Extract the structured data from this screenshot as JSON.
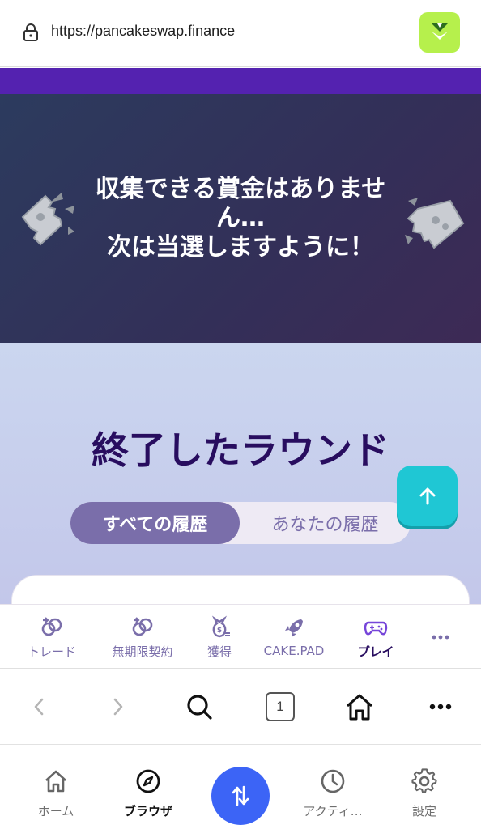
{
  "browser": {
    "url": "https://pancakeswap.finance",
    "icons": {
      "lock": "lock-icon",
      "wallet_logo": "wallet-logo-icon"
    }
  },
  "hero": {
    "message_line1": "収集できる賞金はありませ",
    "message_line2": "ん…",
    "message_line3": "次は当選しますように！"
  },
  "rounds": {
    "title": "終了したラウンド",
    "tabs": [
      {
        "label": "すべての履歴",
        "active": true
      },
      {
        "label": "あなたの履歴",
        "active": false
      }
    ]
  },
  "pcs_nav": {
    "items": [
      {
        "label": "トレード",
        "icon": "trade-icon"
      },
      {
        "label": "無期限契約",
        "icon": "perpetual-icon"
      },
      {
        "label": "獲得",
        "icon": "earn-icon"
      },
      {
        "label": "CAKE.PAD",
        "icon": "rocket-icon"
      },
      {
        "label": "プレイ",
        "icon": "gamepad-icon",
        "active": true
      },
      {
        "label": "",
        "icon": "more-icon"
      }
    ]
  },
  "browser_nav": {
    "tab_count": "1"
  },
  "app_tabbar": {
    "items": [
      {
        "label": "ホーム",
        "icon": "home-icon"
      },
      {
        "label": "ブラウザ",
        "icon": "compass-icon",
        "active": true
      },
      {
        "label": "",
        "icon": "swap-icon"
      },
      {
        "label": "アクティ…",
        "icon": "clock-icon"
      },
      {
        "label": "設定",
        "icon": "gear-icon"
      }
    ]
  },
  "colors": {
    "accent_purple": "#5422b0",
    "pcs_text": "#7a6eaa",
    "pcs_dark": "#280d5f",
    "teal": "#1fc7d4",
    "swap_blue": "#3c64f6",
    "wallet_green": "#b6f04c"
  }
}
